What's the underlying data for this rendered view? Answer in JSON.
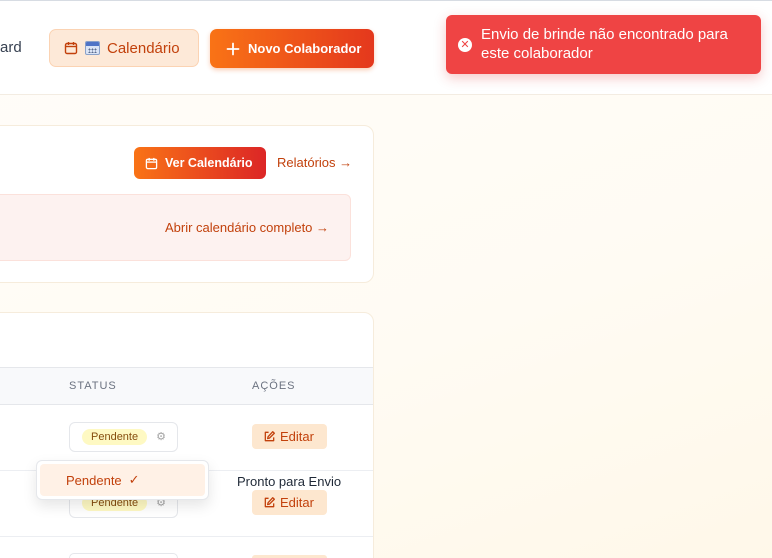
{
  "header": {
    "nav_partial": "ard",
    "calendar_button": {
      "icon": "calendar-icon",
      "emoji_icon": "calendar-emoji-icon",
      "label": "Calendário"
    },
    "new_collaborator_button": {
      "icon": "plus-icon",
      "label": "Novo Colaborador"
    }
  },
  "toast": {
    "icon": "close-circle-icon",
    "message": "Envio de brinde não encontrado para este colaborador",
    "color": "#ef4444"
  },
  "calendar_card": {
    "view_calendar_button": {
      "icon": "calendar-icon",
      "label": "Ver Calendário"
    },
    "reports_link": "Relatórios →",
    "open_full_calendar_link": "Abrir calendário completo →"
  },
  "table": {
    "columns": [
      "STATUS",
      "AÇÕES"
    ],
    "rows": [
      {
        "status": "Pendente",
        "action_label": "Editar"
      },
      {
        "status": "Pendente",
        "action_label": "Editar"
      }
    ],
    "dropdown": {
      "selected_option": "Pendente",
      "check": "✓"
    },
    "row_note": "Pronto para Envio"
  },
  "colors": {
    "accent": "#f97316",
    "accent_dark": "#dc2626",
    "pending_badge_bg": "#fef9c3",
    "edit_button_bg": "#fde7cf"
  }
}
